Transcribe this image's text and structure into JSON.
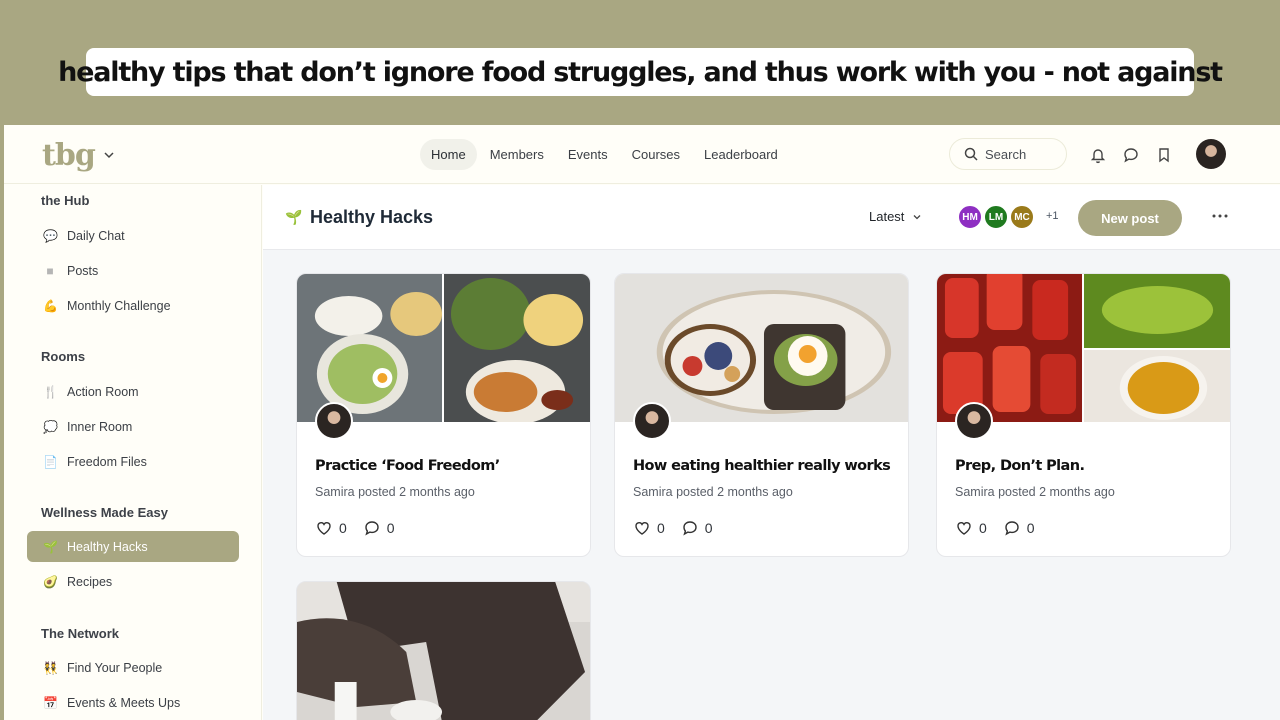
{
  "banner": {
    "text": "healthy tips that don’t ignore food struggles, and thus work with you - not against"
  },
  "topbar": {
    "logo": "tbg",
    "nav": [
      "Home",
      "Members",
      "Events",
      "Courses",
      "Leaderboard"
    ],
    "active_nav": "Home",
    "search_placeholder": "Search",
    "icons": [
      "bell-icon",
      "chat-bubble-icon",
      "bookmark-icon"
    ]
  },
  "sidebar": {
    "sections": [
      {
        "title": "the Hub",
        "items": [
          {
            "icon": "💬",
            "label": "Daily Chat"
          },
          {
            "icon": "■",
            "label": "Posts"
          },
          {
            "icon": "💪",
            "label": "Monthly Challenge"
          }
        ]
      },
      {
        "title": "Rooms",
        "items": [
          {
            "icon": "🍴",
            "label": "Action Room"
          },
          {
            "icon": "💭",
            "label": "Inner Room"
          },
          {
            "icon": "📄",
            "label": "Freedom Files"
          }
        ]
      },
      {
        "title": "Wellness Made Easy",
        "items": [
          {
            "icon": "🌱",
            "label": "Healthy Hacks"
          },
          {
            "icon": "🥑",
            "label": "Recipes"
          }
        ]
      },
      {
        "title": "The Network",
        "items": [
          {
            "icon": "👯",
            "label": "Find Your People"
          },
          {
            "icon": "📅",
            "label": "Events & Meets Ups"
          }
        ]
      }
    ],
    "active_item": "Healthy Hacks"
  },
  "space": {
    "title": "Healthy Hacks",
    "sort_label": "Latest",
    "members": [
      {
        "initials": "HM",
        "color": "#8e2fc2"
      },
      {
        "initials": "LM",
        "color": "#1f7a1f"
      },
      {
        "initials": "MC",
        "color": "#9a7a1a"
      }
    ],
    "members_more": "+1",
    "new_post_label": "New post"
  },
  "posts": [
    {
      "title": "Practice ‘Food Freedom’",
      "meta": "Samira posted 2 months ago",
      "likes": "0",
      "comments": "0"
    },
    {
      "title": "How eating healthier really works",
      "meta": "Samira posted 2 months ago",
      "likes": "0",
      "comments": "0"
    },
    {
      "title": "Prep, Don’t Plan.",
      "meta": "Samira posted 2 months ago",
      "likes": "0",
      "comments": "0"
    },
    {
      "title": "",
      "meta": "",
      "likes": "",
      "comments": ""
    }
  ],
  "colors": {
    "accent": "#a9a782",
    "background": "#fffef8"
  }
}
